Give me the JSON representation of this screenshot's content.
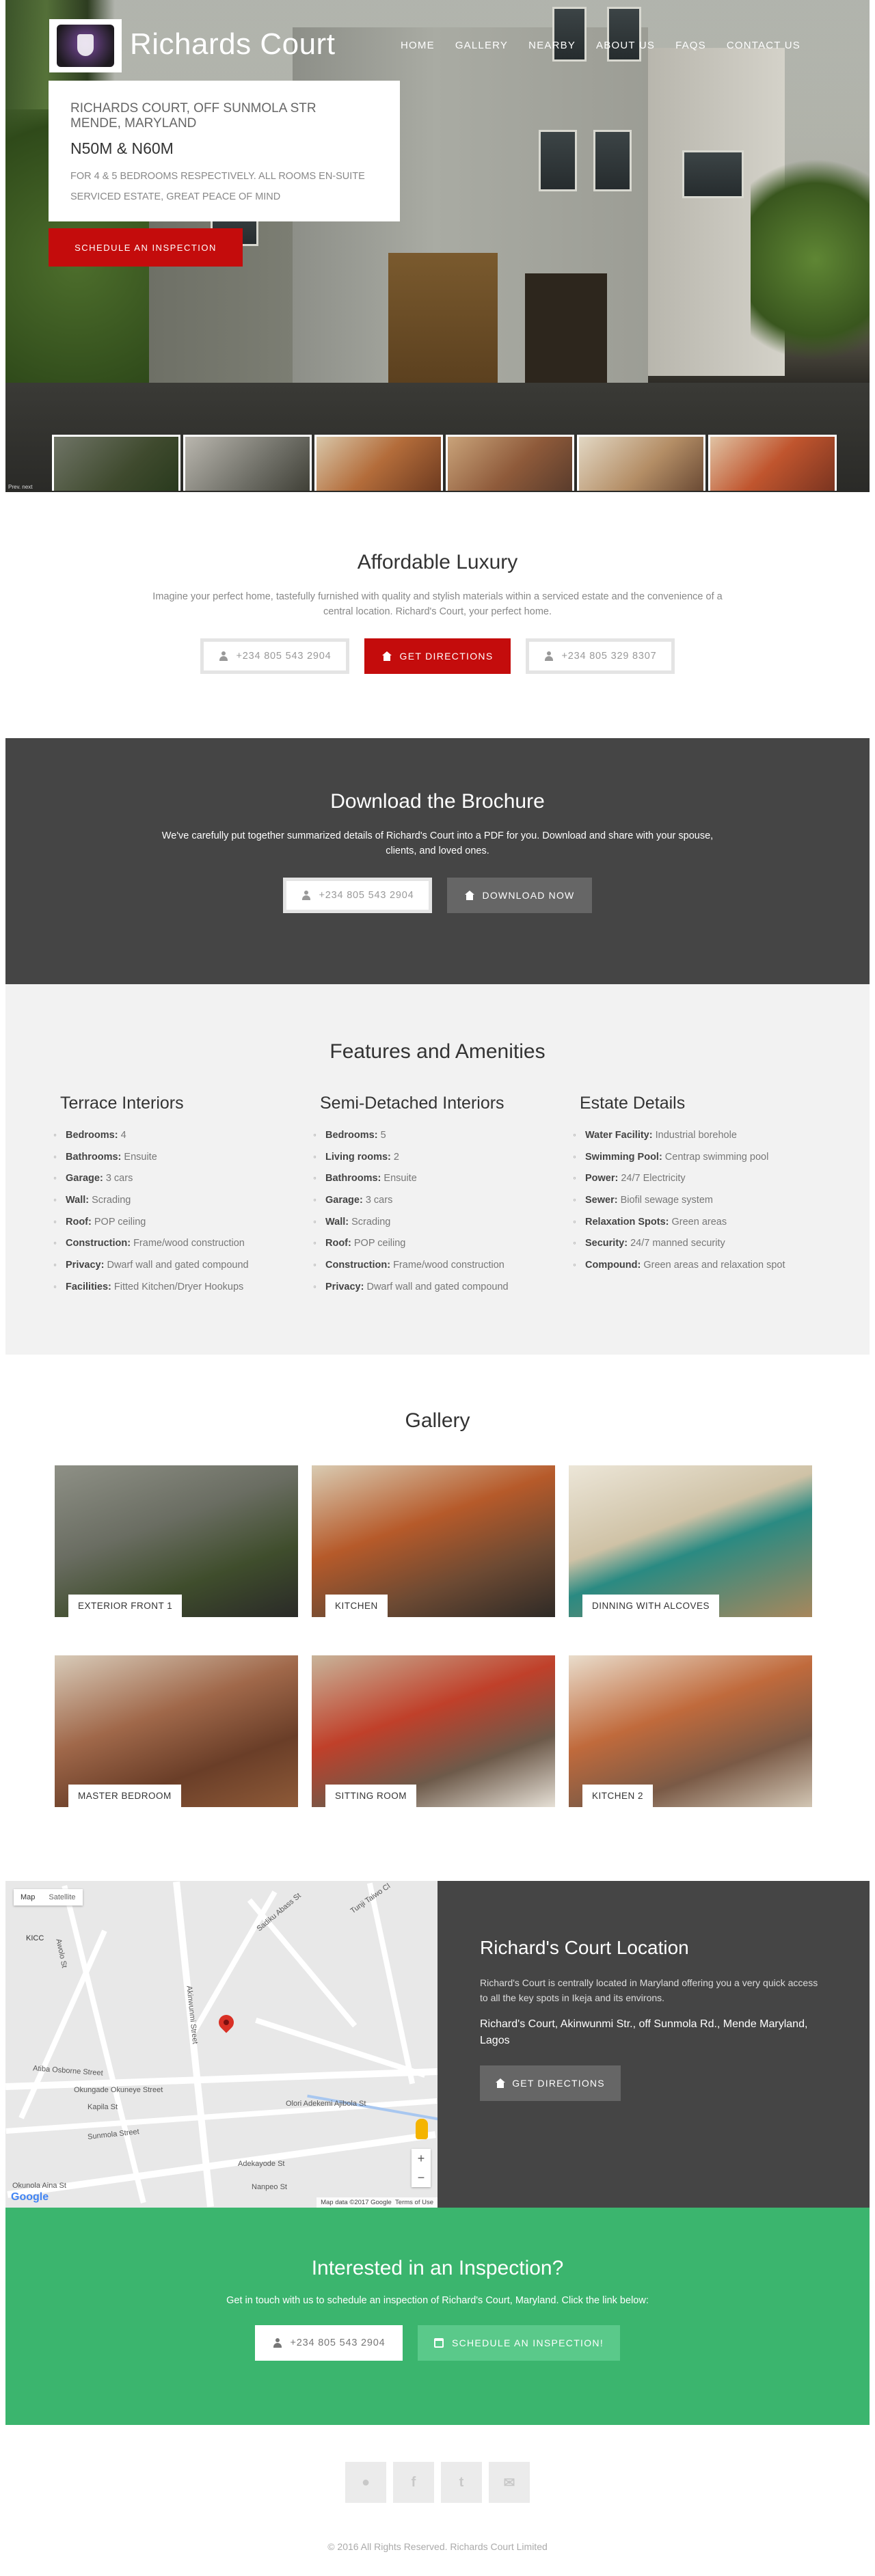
{
  "brand": {
    "name": "Richards Court"
  },
  "nav": [
    "HOME",
    "GALLERY",
    "NEARBY",
    "ABOUT US",
    "FAQS",
    "CONTACT US"
  ],
  "hero": {
    "address_line1": "RICHARDS COURT, OFF SUNMOLA STR",
    "address_line2": "MENDE, MARYLAND",
    "price": "N50M & N60M",
    "desc_line1": "FOR 4 & 5 BEDROOMS RESPECTIVELY. ALL ROOMS EN-SUITE",
    "desc_line2": "SERVICED ESTATE, GREAT PEACE OF MIND",
    "cta": "SCHEDULE AN INSPECTION",
    "photo_tag": "Prev. next"
  },
  "luxury": {
    "title": "Affordable Luxury",
    "text": "Imagine your perfect home, tastefully furnished with quality and stylish materials within a serviced estate and the convenience of a central location. Richard's Court, your perfect home.",
    "phone1": "+234 805 543 2904",
    "directions": "GET DIRECTIONS",
    "phone2": "+234 805 329 8307"
  },
  "brochure": {
    "title": "Download the Brochure",
    "text": "We've carefully put together summarized details of Richard's Court into a PDF for you. Download and share with your spouse, clients, and loved ones.",
    "phone": "+234 805 543 2904",
    "download": "DOWNLOAD NOW"
  },
  "features": {
    "title": "Features and Amenities",
    "columns": [
      {
        "title": "Terrace Interiors",
        "items": [
          {
            "k": "Bedrooms:",
            "v": " 4"
          },
          {
            "k": "Bathrooms:",
            "v": " Ensuite"
          },
          {
            "k": "Garage:",
            "v": " 3 cars"
          },
          {
            "k": "Wall:",
            "v": " Scrading"
          },
          {
            "k": "Roof:",
            "v": " POP ceiling"
          },
          {
            "k": "Construction:",
            "v": " Frame/wood construction"
          },
          {
            "k": "Privacy:",
            "v": " Dwarf wall and gated compound"
          },
          {
            "k": "Facilities:",
            "v": " Fitted Kitchen/Dryer Hookups"
          }
        ]
      },
      {
        "title": "Semi-Detached Interiors",
        "items": [
          {
            "k": "Bedrooms:",
            "v": " 5"
          },
          {
            "k": "Living rooms:",
            "v": " 2"
          },
          {
            "k": "Bathrooms:",
            "v": " Ensuite"
          },
          {
            "k": "Garage:",
            "v": " 3 cars"
          },
          {
            "k": "Wall:",
            "v": " Scrading"
          },
          {
            "k": "Roof:",
            "v": " POP ceiling"
          },
          {
            "k": "Construction:",
            "v": " Frame/wood construction"
          },
          {
            "k": "Privacy:",
            "v": " Dwarf wall and gated compound"
          }
        ]
      },
      {
        "title": "Estate Details",
        "items": [
          {
            "k": "Water Facility:",
            "v": " Industrial borehole"
          },
          {
            "k": "Swimming Pool:",
            "v": " Centrap swimming pool"
          },
          {
            "k": "Power:",
            "v": " 24/7 Electricity"
          },
          {
            "k": "Sewer:",
            "v": " Biofil sewage system"
          },
          {
            "k": "Relaxation Spots:",
            "v": " Green areas"
          },
          {
            "k": "Security:",
            "v": " 24/7 manned security"
          },
          {
            "k": "Compound:",
            "v": " Green areas and relaxation spot"
          }
        ]
      }
    ]
  },
  "gallery": {
    "title": "Gallery",
    "items": [
      "EXTERIOR FRONT 1",
      "KITCHEN",
      "DINNING WITH ALCOVES",
      "MASTER BEDROOM",
      "SITTING ROOM",
      "KITCHEN 2"
    ]
  },
  "map": {
    "tab_map": "Map",
    "tab_satellite": "Satellite",
    "poi": "KICC",
    "streets": [
      "Awolo St",
      "Sadiku Abass St",
      "Tunji Taiwo Cl",
      "Akinwunmi Street",
      "Atiba Osborne Street",
      "Okungade Okuneye Street",
      "Kapila St",
      "Sunmola Street",
      "Olori Adekemi Ajibola St",
      "Adekayode St",
      "Okunola Aina St",
      "Nanpeo St"
    ],
    "attribution": "Map data ©2017 Google",
    "terms": "Terms of Use",
    "google": "Google"
  },
  "location": {
    "title": "Richard's Court Location",
    "text": "Richard's Court is centrally located in Maryland offering you a very quick access to all the key spots in Ikeja and its environs.",
    "street": "Richard's Court, Akinwunmi Str., off Sunmola Rd., Mende Maryland, Lagos",
    "directions": "GET DIRECTIONS"
  },
  "inspection": {
    "title": "Interested in an Inspection?",
    "text": "Get in touch with us to schedule an inspection of Richard's Court, Maryland. Click the link below:",
    "phone": "+234 805 543 2904",
    "cta": "SCHEDULE AN INSPECTION!"
  },
  "footer": {
    "copyright": "© 2016 All Rights Reserved. Richards Court Limited",
    "social_icons": [
      "map-marker-icon",
      "facebook-icon",
      "twitter-icon",
      "email-icon"
    ]
  },
  "colors": {
    "red": "#c40c0c",
    "dark": "#454545",
    "green": "#3bb56e",
    "light_bg": "#f2f2f2"
  }
}
